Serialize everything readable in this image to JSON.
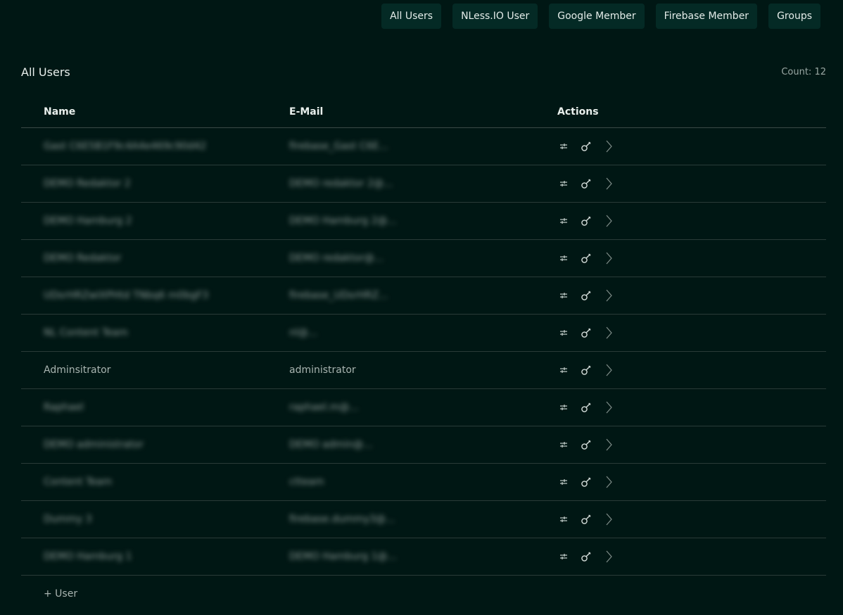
{
  "nav": {
    "buttons": [
      "All Users",
      "NLess.IO User",
      "Google Member",
      "Firebase Member",
      "Groups"
    ]
  },
  "list": {
    "title": "All Users",
    "count": "Count: 12"
  },
  "table": {
    "headers": {
      "name": "Name",
      "email": "E-Mail",
      "actions": "Actions"
    },
    "rows": [
      {
        "name": "Gast C6E5B1F9c4A4e469c90d42",
        "email": "firebase_Gast C6E...",
        "blurred": true
      },
      {
        "name": "DEMO Redaktor 2",
        "email": "DEMO redaktor 2@...",
        "blurred": true
      },
      {
        "name": "DEMO Hamburg 2",
        "email": "DEMO Hamburg 2@...",
        "blurred": true
      },
      {
        "name": "DEMO Redaktor",
        "email": "DEMO redaktor@...",
        "blurred": true
      },
      {
        "name": "UDsrHRZwIXPHtd TNbq6 m0bgF3",
        "email": "firebase_UDsrHRZ...",
        "blurred": true
      },
      {
        "name": "NL Content Team",
        "email": "nl@...",
        "blurred": true
      },
      {
        "name": "Adminsitrator",
        "email": "administrator",
        "blurred": false
      },
      {
        "name": "Raphael",
        "email": "raphael.m@...",
        "blurred": true
      },
      {
        "name": "DEMO administrator",
        "email": "DEMO admin@...",
        "blurred": true
      },
      {
        "name": "Content Team",
        "email": "ctteam",
        "blurred": true
      },
      {
        "name": "Dummy 3",
        "email": "firebase.dummy3@...",
        "blurred": true
      },
      {
        "name": "DEMO Hamburg 1",
        "email": "DEMO Hamburg 1@...",
        "blurred": true
      }
    ]
  },
  "add_user_label": "+ User",
  "icons": [
    "sliders-icon",
    "key-icon",
    "chevron-right-icon"
  ],
  "colors": {
    "background": "#001714",
    "button_bg": "#042a25",
    "divider": "#2a3b38"
  }
}
